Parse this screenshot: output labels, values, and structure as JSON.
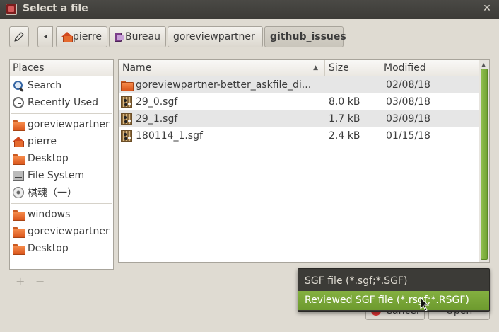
{
  "window": {
    "title": "Select a file",
    "close_glyph": "✕"
  },
  "pathbar": {
    "left_arrow": "◂",
    "crumbs": [
      {
        "label": "pierre",
        "icon": "home-icon"
      },
      {
        "label": "Bureau",
        "icon": "desktop-icon"
      },
      {
        "label": "goreviewpartner"
      },
      {
        "label": "github_issues",
        "active": true
      }
    ]
  },
  "places": {
    "header": "Places",
    "items": [
      {
        "label": "Search",
        "icon": "search-icon"
      },
      {
        "label": "Recently Used",
        "icon": "recent-icon"
      },
      {
        "label": "goreviewpartner",
        "icon": "folder-icon"
      },
      {
        "label": "pierre",
        "icon": "home-icon"
      },
      {
        "label": "Desktop",
        "icon": "folder-icon"
      },
      {
        "label": "File System",
        "icon": "drive-icon"
      },
      {
        "label": "棋魂（一）",
        "icon": "cd-icon"
      },
      {
        "label": "windows",
        "icon": "folder-icon"
      },
      {
        "label": "goreviewpartner",
        "icon": "folder-icon"
      },
      {
        "label": "Desktop",
        "icon": "folder-icon"
      }
    ],
    "add_label": "+",
    "remove_label": "−"
  },
  "filelist": {
    "columns": {
      "name": "Name",
      "size": "Size",
      "modified": "Modified"
    },
    "sort_indicator": "▲",
    "rows": [
      {
        "name": "goreviewpartner-better_askfile_di...",
        "size": "",
        "modified": "02/08/18",
        "icon": "folder-icon"
      },
      {
        "name": "29_0.sgf",
        "size": "8.0 kB",
        "modified": "03/08/18",
        "icon": "sgf-file-icon"
      },
      {
        "name": "29_1.sgf",
        "size": "1.7 kB",
        "modified": "03/09/18",
        "icon": "sgf-file-icon"
      },
      {
        "name": "180114_1.sgf",
        "size": "2.4 kB",
        "modified": "01/15/18",
        "icon": "sgf-file-icon"
      }
    ]
  },
  "scrollbar": {
    "up_arrow": "▲"
  },
  "buttons": {
    "cancel": "Cancel",
    "open": "Open"
  },
  "filter_popup": {
    "options": [
      "SGF file (*.sgf;*.SGF)",
      "Reviewed SGF file (*.rsgf;*.RSGF)"
    ],
    "selected_index": 1
  },
  "colors": {
    "accent": "#7aab39",
    "titlebar": "#3c3b37",
    "window_bg": "#dfdbd2"
  }
}
